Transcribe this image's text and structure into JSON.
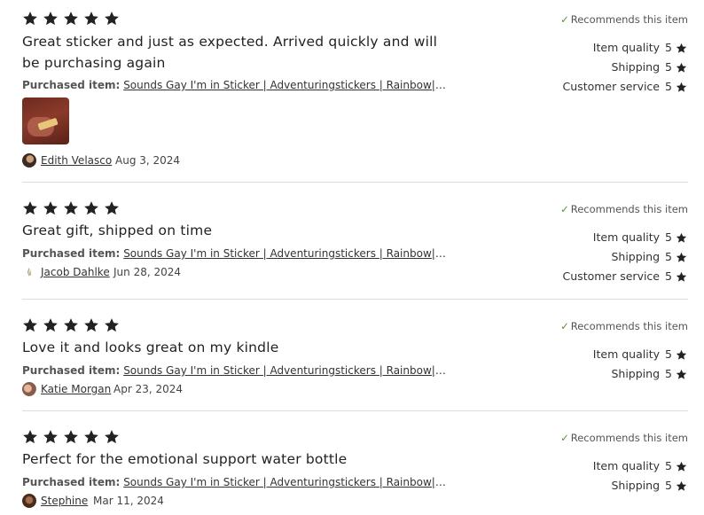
{
  "colors": {
    "star": "#222222",
    "check": "#5a8f3a",
    "divider": "#dddddd"
  },
  "icons": {
    "star": "star-icon",
    "check": "checkmark-icon"
  },
  "reviews": [
    {
      "rating": 5,
      "text": "Great sticker and just as expected. Arrived quickly and will be purchasing again",
      "purchased_label": "Purchased item:",
      "purchased_item": "Sounds Gay I'm in Sticker | Adventuringstickers | Rainbow| Sticker",
      "has_photo": true,
      "reviewer": "Edith Velasco",
      "date": "Aug 3, 2024",
      "recommends": "Recommends this item",
      "ratings": [
        {
          "label": "Item quality",
          "value": "5"
        },
        {
          "label": "Shipping",
          "value": "5"
        },
        {
          "label": "Customer service",
          "value": "5"
        }
      ]
    },
    {
      "rating": 5,
      "text": "Great gift, shipped on time",
      "purchased_label": "Purchased item:",
      "purchased_item": "Sounds Gay I'm in Sticker | Adventuringstickers | Rainbow| Sticker",
      "has_photo": false,
      "reviewer": "Jacob Dahlke",
      "date": "Jun 28, 2024",
      "recommends": "Recommends this item",
      "ratings": [
        {
          "label": "Item quality",
          "value": "5"
        },
        {
          "label": "Shipping",
          "value": "5"
        },
        {
          "label": "Customer service",
          "value": "5"
        }
      ]
    },
    {
      "rating": 5,
      "text": "Love it and looks great on my kindle",
      "purchased_label": "Purchased item:",
      "purchased_item": "Sounds Gay I'm in Sticker | Adventuringstickers | Rainbow| Sticker",
      "has_photo": false,
      "reviewer": "Katie Morgan",
      "date": "Apr 23, 2024",
      "recommends": "Recommends this item",
      "ratings": [
        {
          "label": "Item quality",
          "value": "5"
        },
        {
          "label": "Shipping",
          "value": "5"
        }
      ]
    },
    {
      "rating": 5,
      "text": "Perfect for the emotional support water bottle",
      "purchased_label": "Purchased item:",
      "purchased_item": "Sounds Gay I'm in Sticker | Adventuringstickers | Rainbow| Sticker",
      "has_photo": false,
      "reviewer": "Stephine",
      "date": "Mar 11, 2024",
      "recommends": "Recommends this item",
      "ratings": [
        {
          "label": "Item quality",
          "value": "5"
        },
        {
          "label": "Shipping",
          "value": "5"
        }
      ]
    }
  ]
}
